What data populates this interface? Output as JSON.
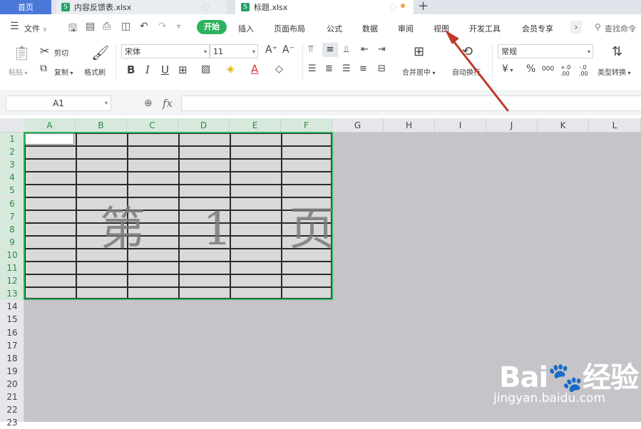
{
  "tabs": [
    {
      "label": "首页"
    },
    {
      "label": "内容反馈表.xlsx",
      "badge": "S"
    },
    {
      "label": "标题.xlsx",
      "badge": "S"
    }
  ],
  "add_tab": "+",
  "menu": {
    "file": "文件",
    "start": "开始",
    "items": [
      "插入",
      "页面布局",
      "公式",
      "数据",
      "审阅",
      "视图",
      "开发工具",
      "会员专享"
    ],
    "more": "›",
    "search_placeholder": "查找命令"
  },
  "ribbon": {
    "paste": "粘贴",
    "cut": "剪切",
    "copy": "复制",
    "format_painter": "格式刷",
    "font_name": "宋体",
    "font_size": "11",
    "bold": "B",
    "italic": "I",
    "underline": "U",
    "font_grow": "A⁺",
    "font_shrink": "A⁻",
    "font_color": "A",
    "merge_center": "合并居中",
    "wrap_text": "自动换行",
    "number_format": "常规",
    "currency": "¥",
    "percent": "%",
    "thousands": "000",
    "inc_decimal": "+.0 .00",
    "dec_decimal": "-.0 .00",
    "type_convert": "类型转换"
  },
  "formula_bar": {
    "cell_ref": "A1",
    "fx": "fx"
  },
  "columns": [
    "A",
    "B",
    "C",
    "D",
    "E",
    "F",
    "G",
    "H",
    "I",
    "J",
    "K",
    "L"
  ],
  "rows": [
    "1",
    "2",
    "3",
    "4",
    "5",
    "6",
    "7",
    "8",
    "9",
    "10",
    "11",
    "12",
    "13",
    "14",
    "15",
    "16",
    "17",
    "18",
    "19",
    "20",
    "21",
    "22",
    "23"
  ],
  "page_watermark": "第 1 页",
  "watermark": {
    "logo": "Bai🐾经验",
    "url": "jingyan.baidu.com"
  },
  "colors": {
    "accent_green": "#2db35d",
    "home_tab_blue": "#4a78d8",
    "arrow_red": "#c0392b"
  }
}
